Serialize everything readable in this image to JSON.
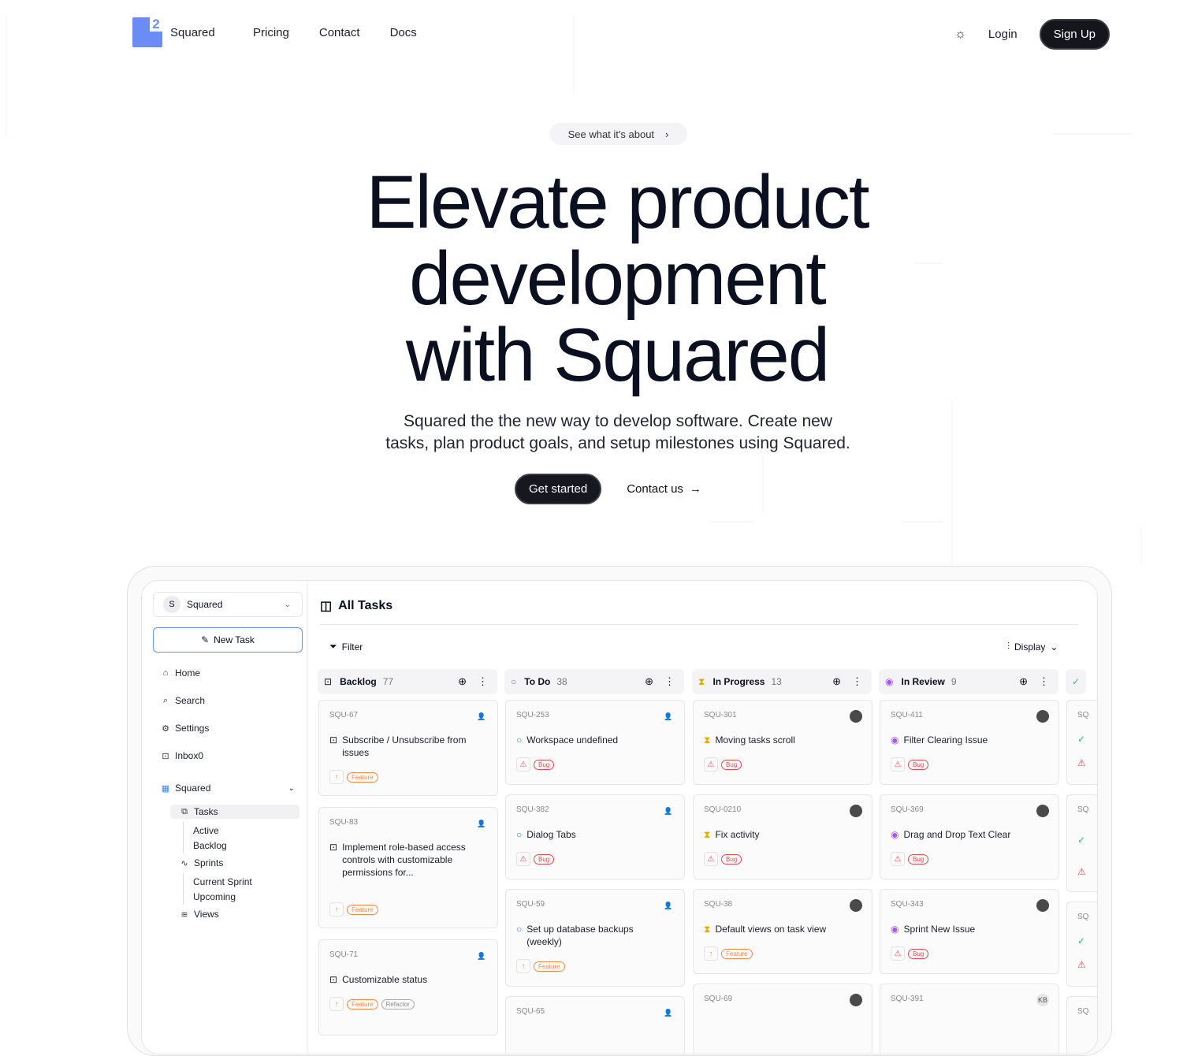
{
  "nav": {
    "brand": "Squared",
    "links": [
      "Pricing",
      "Contact",
      "Docs"
    ],
    "login": "Login",
    "signup": "Sign Up",
    "theme_icon": "sun-icon"
  },
  "hero": {
    "pill": "See what it's about",
    "title_lines": [
      "Elevate product",
      "development",
      "with Squared"
    ],
    "subtitle_lines": [
      "Squared the the new way to develop software. Create new",
      "tasks, plan product goals, and setup milestones using Squared."
    ],
    "cta_primary": "Get started",
    "cta_secondary": "Contact us"
  },
  "app": {
    "workspace": {
      "initial": "S",
      "name": "Squared"
    },
    "new_task": "New Task",
    "sidebar_items": [
      "Home",
      "Search",
      "Settings",
      "Inbox0"
    ],
    "group": "Squared",
    "tasks": "Tasks",
    "tasks_sub": [
      "Active",
      "Backlog"
    ],
    "sprints": "Sprints",
    "sprints_sub": [
      "Current Sprint",
      "Upcoming"
    ],
    "views": "Views",
    "title": "All Tasks",
    "filter": "Filter",
    "display": "Display",
    "columns": [
      {
        "name": "Backlog",
        "count": "77",
        "icon": "inbox-icon",
        "color": "#555555"
      },
      {
        "name": "To Do",
        "count": "38",
        "icon": "circle-icon",
        "color": "#3b82f6"
      },
      {
        "name": "In Progress",
        "count": "13",
        "icon": "hourglass-icon",
        "color": "#e0a800"
      },
      {
        "name": "In Review",
        "count": "9",
        "icon": "eye-icon",
        "color": "#a855f7"
      }
    ],
    "done_icon_color": "#22c55e",
    "cards": {
      "backlog": [
        {
          "id": "SQU-67",
          "title": "Subscribe / Unsubscribe from issues",
          "tags": [
            "Feature"
          ]
        },
        {
          "id": "SQU-83",
          "title": "Implement role-based access controls with customizable permissions for...",
          "tags": [
            "Feature"
          ]
        },
        {
          "id": "SQU-71",
          "title": "Customizable status",
          "tags": [
            "Feature",
            "Refactor"
          ]
        }
      ],
      "todo": [
        {
          "id": "SQU-253",
          "title": "Workspace undefined",
          "tags": [
            "Bug"
          ]
        },
        {
          "id": "SQU-382",
          "title": "Dialog Tabs",
          "tags": [
            "Bug"
          ]
        },
        {
          "id": "SQU-59",
          "title": "Set up database backups (weekly)",
          "tags": [
            "Feature"
          ]
        },
        {
          "id": "SQU-65",
          "title": "",
          "tags": []
        }
      ],
      "progress": [
        {
          "id": "SQU-301",
          "title": "Moving tasks scroll",
          "tags": [
            "Bug"
          ]
        },
        {
          "id": "SQU-0210",
          "title": "Fix activity",
          "tags": [
            "Bug"
          ]
        },
        {
          "id": "SQU-38",
          "title": "Default views on task view",
          "tags": [
            "Feature"
          ]
        },
        {
          "id": "SQU-69",
          "title": "",
          "tags": []
        }
      ],
      "review": [
        {
          "id": "SQU-411",
          "title": "Filter Clearing Issue",
          "tags": [
            "Bug"
          ]
        },
        {
          "id": "SQU-369",
          "title": "Drag and Drop Text Clear",
          "tags": [
            "Bug"
          ]
        },
        {
          "id": "SQU-343",
          "title": "Sprint New Issue",
          "tags": [
            "Bug"
          ]
        },
        {
          "id": "SQU-391",
          "title": "",
          "tags": [],
          "assignee": "KB"
        }
      ],
      "done_partial_id": "SQ"
    }
  }
}
